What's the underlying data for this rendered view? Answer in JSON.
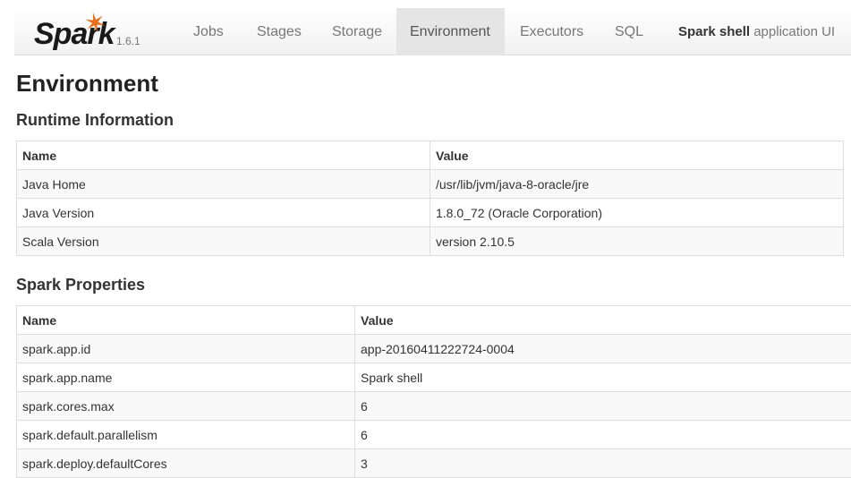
{
  "brand": {
    "name": "Spark",
    "version": "1.6.1"
  },
  "nav": {
    "items": [
      {
        "label": "Jobs",
        "active": false
      },
      {
        "label": "Stages",
        "active": false
      },
      {
        "label": "Storage",
        "active": false
      },
      {
        "label": "Environment",
        "active": true
      },
      {
        "label": "Executors",
        "active": false
      },
      {
        "label": "SQL",
        "active": false
      }
    ],
    "app_title_bold": "Spark shell",
    "app_title_rest": " application UI"
  },
  "page": {
    "title": "Environment",
    "runtime_heading": "Runtime Information",
    "spark_heading": "Spark Properties"
  },
  "runtime_table": {
    "headers": [
      "Name",
      "Value"
    ],
    "rows": [
      [
        "Java Home",
        "/usr/lib/jvm/java-8-oracle/jre"
      ],
      [
        "Java Version",
        "1.8.0_72 (Oracle Corporation)"
      ],
      [
        "Scala Version",
        "version 2.10.5"
      ]
    ]
  },
  "spark_table": {
    "headers": [
      "Name",
      "Value"
    ],
    "rows": [
      [
        "spark.app.id",
        "app-20160411222724-0004"
      ],
      [
        "spark.app.name",
        "Spark shell"
      ],
      [
        "spark.cores.max",
        "6"
      ],
      [
        "spark.default.parallelism",
        "6"
      ],
      [
        "spark.deploy.defaultCores",
        "3"
      ]
    ]
  },
  "colors": {
    "brand_star": "#e86e1c",
    "active_tab_bg": "#e5e5e5"
  }
}
